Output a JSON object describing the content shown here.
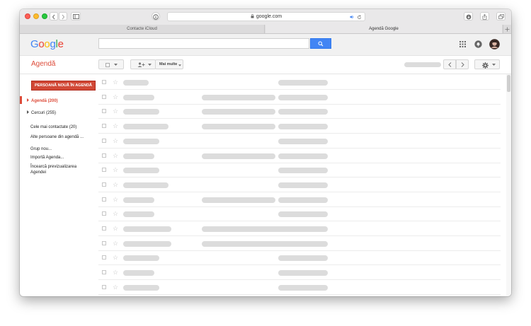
{
  "browser": {
    "url": "google.com",
    "tabs": [
      {
        "label": "Contacte iCloud",
        "active": false
      },
      {
        "label": "Agendă Google",
        "active": true
      }
    ],
    "new_tab_icon": "plus-icon"
  },
  "header": {
    "logo_letters": [
      {
        "char": "G",
        "color": "#4285f4"
      },
      {
        "char": "o",
        "color": "#ea4335"
      },
      {
        "char": "o",
        "color": "#fbbc05"
      },
      {
        "char": "g",
        "color": "#4285f4"
      },
      {
        "char": "l",
        "color": "#34a853"
      },
      {
        "char": "e",
        "color": "#ea4335"
      }
    ],
    "search_placeholder": ""
  },
  "app": {
    "title": "Agendă",
    "more_button": "Mai multe"
  },
  "sidebar": {
    "new_contact_button": "PERSOANĂ NOUĂ ÎN AGENDĂ",
    "items": [
      {
        "label": "Agendă (200)",
        "active": true,
        "expandable": true
      },
      {
        "label": "Cercuri (255)",
        "active": false,
        "expandable": true
      },
      {
        "label": "Cele mai contactate (20)",
        "active": false,
        "expandable": false
      },
      {
        "label": "Alte persoane din agendă ...",
        "active": false,
        "expandable": false
      },
      {
        "label": "Grup nou...",
        "active": false,
        "expandable": false
      },
      {
        "label": "Importă Agenda...",
        "active": false,
        "expandable": false
      },
      {
        "label": "Încearcă previzualizarea Agendei",
        "active": false,
        "expandable": false
      }
    ]
  },
  "contacts": {
    "row_count": 15,
    "rows": [
      {
        "name": true,
        "col2": false,
        "col3": true
      },
      {
        "name": true,
        "col2": true,
        "col3": true
      },
      {
        "name": true,
        "col2": true,
        "col3": true
      },
      {
        "name": true,
        "col2": true,
        "col3": true
      },
      {
        "name": true,
        "col2": false,
        "col3": true
      },
      {
        "name": true,
        "col2": true,
        "col3": true
      },
      {
        "name": true,
        "col2": false,
        "col3": true
      },
      {
        "name": true,
        "col2": false,
        "col3": true
      },
      {
        "name": true,
        "col2": true,
        "col3": true
      },
      {
        "name": true,
        "col2": false,
        "col3": true
      },
      {
        "name": true,
        "col2": true,
        "col3": false
      },
      {
        "name": true,
        "col2": true,
        "col3": false
      },
      {
        "name": true,
        "col2": false,
        "col3": true
      },
      {
        "name": true,
        "col2": false,
        "col3": true
      },
      {
        "name": true,
        "col2": false,
        "col3": true
      }
    ]
  },
  "colors": {
    "accent": "#dd4b39",
    "search_blue": "#4285f4",
    "placeholder": "#dcdcdc"
  }
}
